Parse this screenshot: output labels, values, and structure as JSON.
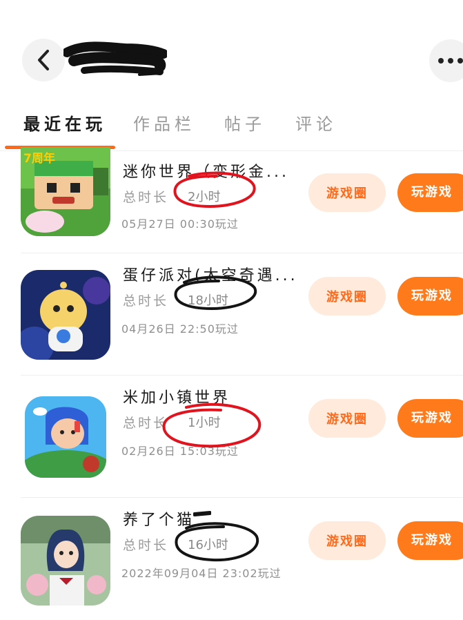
{
  "header": {
    "back_icon": "chevron-left-icon",
    "more_icon": "more-dots-icon"
  },
  "tabs": [
    {
      "label": "最近在玩",
      "active": true
    },
    {
      "label": "作品栏",
      "active": false
    },
    {
      "label": "帖子",
      "active": false
    },
    {
      "label": "评论",
      "active": false
    }
  ],
  "colors": {
    "accent": "#ff7a1a",
    "accent_light": "#ffeadc"
  },
  "games": [
    {
      "title": "迷你世界（变形金...",
      "duration_label": "总时长",
      "duration": "2小时",
      "played_at": "05月27日 00:30玩过",
      "circle_label": "游戏圈",
      "play_label": "玩游戏"
    },
    {
      "title": "蛋仔派对(太空奇遇...",
      "duration_label": "总时长",
      "duration": "18小时",
      "played_at": "04月26日 22:50玩过",
      "circle_label": "游戏圈",
      "play_label": "玩游戏"
    },
    {
      "title": "米加小镇世界",
      "duration_label": "总时长",
      "duration": "1小时",
      "played_at": "02月26日 15:03玩过",
      "circle_label": "游戏圈",
      "play_label": "玩游戏"
    },
    {
      "title": "养了个猫",
      "duration_label": "总时长",
      "duration": "16小时",
      "played_at": "2022年09月04日 23:02玩过",
      "circle_label": "游戏圈",
      "play_label": "玩游戏"
    }
  ]
}
